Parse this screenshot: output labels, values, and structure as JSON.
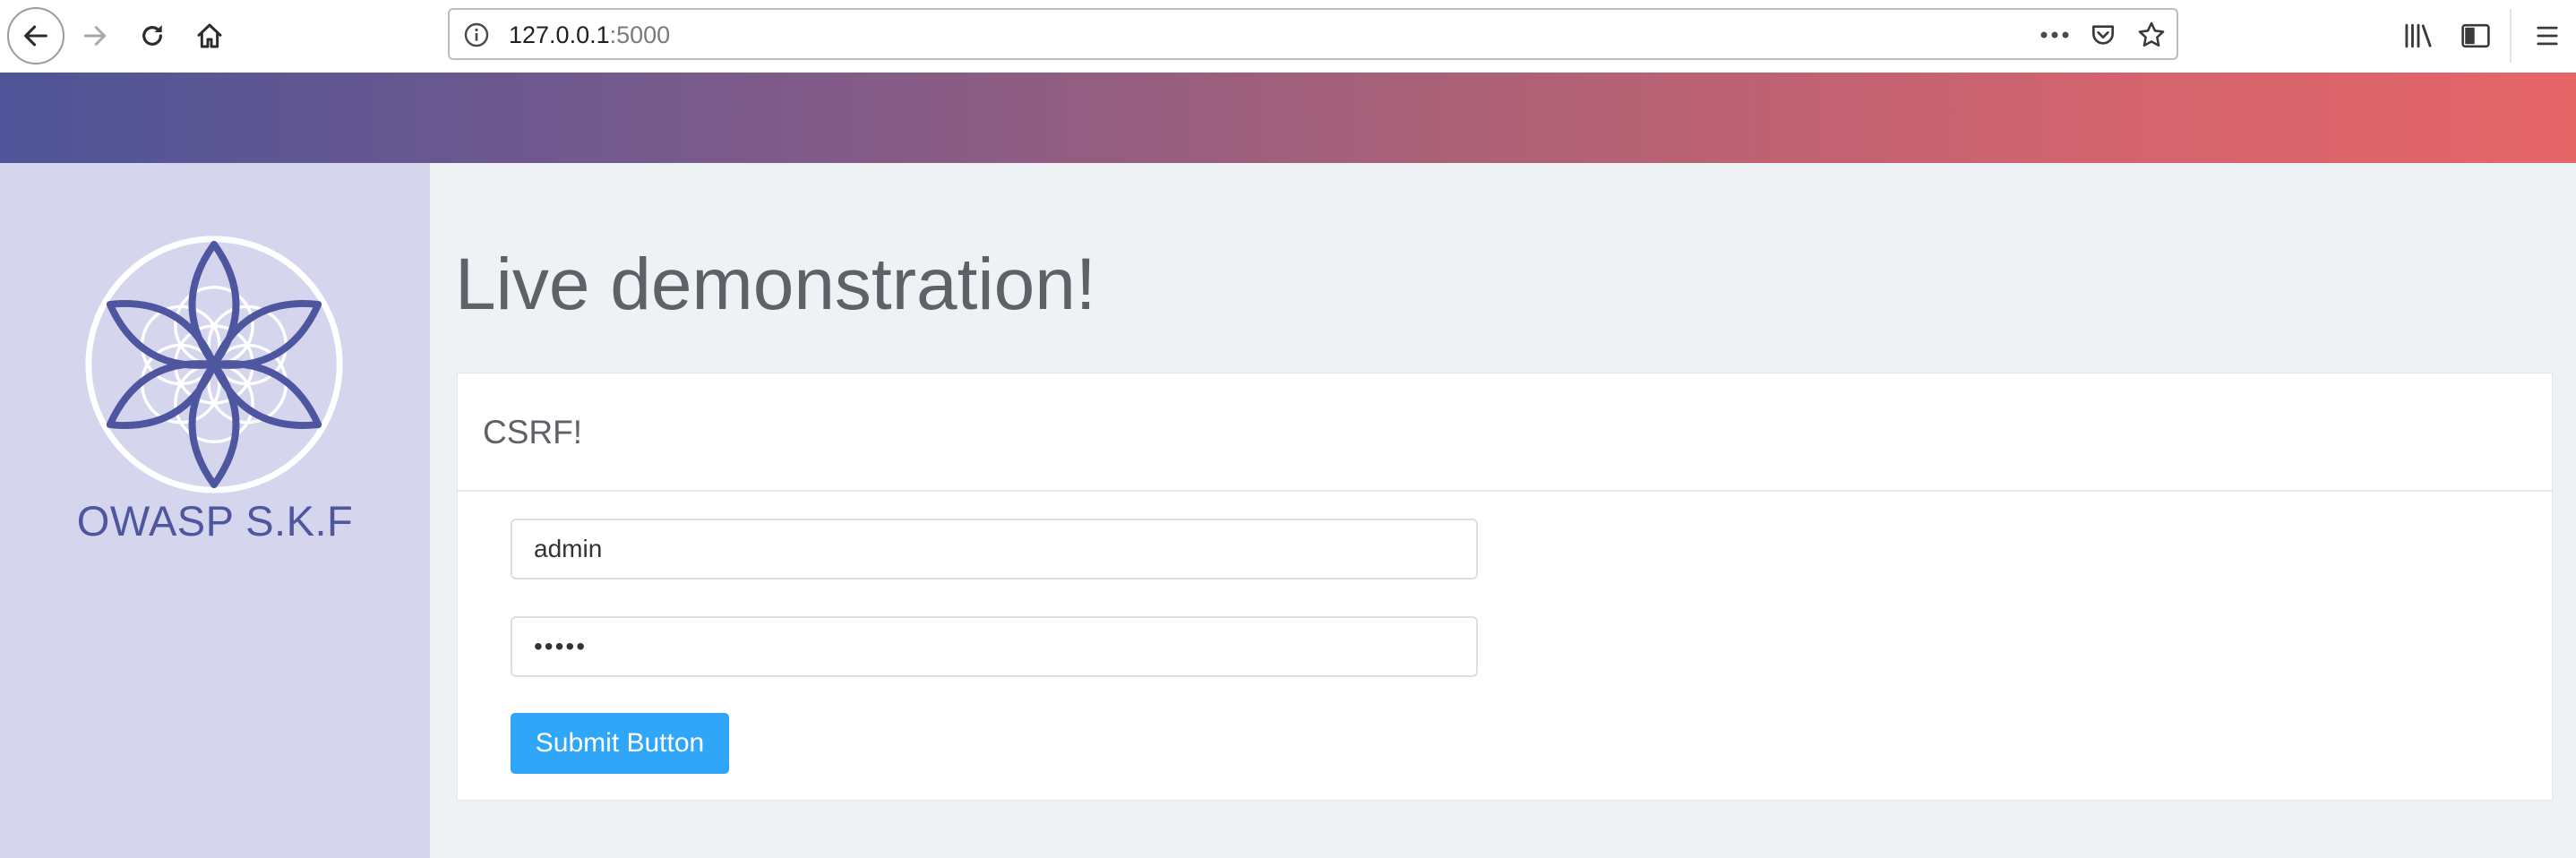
{
  "browser": {
    "url_host": "127.0.0.1",
    "url_port": ":5000",
    "icons": [
      "back-icon",
      "forward-icon",
      "reload-icon",
      "home-icon",
      "info-icon",
      "more-icon",
      "pocket-icon",
      "bookmark-star-icon",
      "library-icon",
      "sidebar-icon",
      "menu-icon"
    ]
  },
  "header": {
    "gradient_start": "#4d5497",
    "gradient_end": "#e66668"
  },
  "sidebar": {
    "brand": "OWASP S.K.F",
    "logo_color": "#4f56a0",
    "background": "#d6d5ee"
  },
  "main": {
    "title": "Live demonstration!",
    "card": {
      "title": "CSRF!",
      "username_value": "admin",
      "password_value": "•••••",
      "submit_label": "Submit Button",
      "submit_color": "#2fa6f8"
    }
  }
}
